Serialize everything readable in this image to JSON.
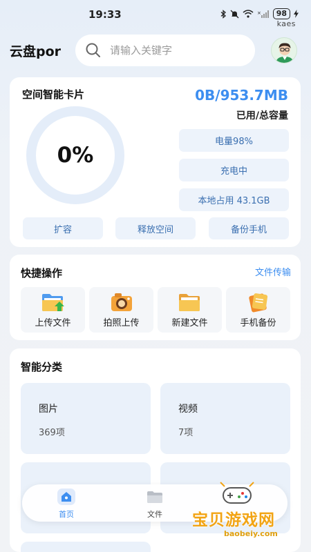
{
  "status_bar": {
    "time": "19:33",
    "battery": "98",
    "carrier_label": "kaes"
  },
  "header": {
    "app_title": "云盘por",
    "search_placeholder": "请输入关键字"
  },
  "storage_card": {
    "title": "空间智能卡片",
    "used_value": "0B/953.7MB",
    "used_caption": "已用/总容量",
    "usage_percent": "0%",
    "battery_level": "电量98%",
    "charging_status": "充电中",
    "local_usage": "本地占用 43.1GB",
    "actions": [
      "扩容",
      "释放空间",
      "备份手机"
    ]
  },
  "quick_actions": {
    "title": "快捷操作",
    "link": "文件传输",
    "items": [
      {
        "label": "上传文件",
        "icon": "upload-folder-icon"
      },
      {
        "label": "拍照上传",
        "icon": "camera-icon"
      },
      {
        "label": "新建文件",
        "icon": "new-folder-icon"
      },
      {
        "label": "手机备份",
        "icon": "phone-backup-icon"
      }
    ]
  },
  "smart_category": {
    "title": "智能分类",
    "tiles": [
      {
        "name": "图片",
        "count": "369项"
      },
      {
        "name": "视频",
        "count": "7项"
      }
    ]
  },
  "bottom_nav": {
    "items": [
      {
        "label": "首页",
        "icon": "home-icon",
        "active": true
      },
      {
        "label": "文件",
        "icon": "folder-icon",
        "active": false
      }
    ]
  },
  "watermark": {
    "text": "宝贝游戏网",
    "url": "baobeiy.com"
  },
  "colors": {
    "accent": "#3d8ef0",
    "pill_bg": "#edf3fb",
    "tile_bg": "#eaf1fa",
    "watermark": "#f2a414"
  }
}
